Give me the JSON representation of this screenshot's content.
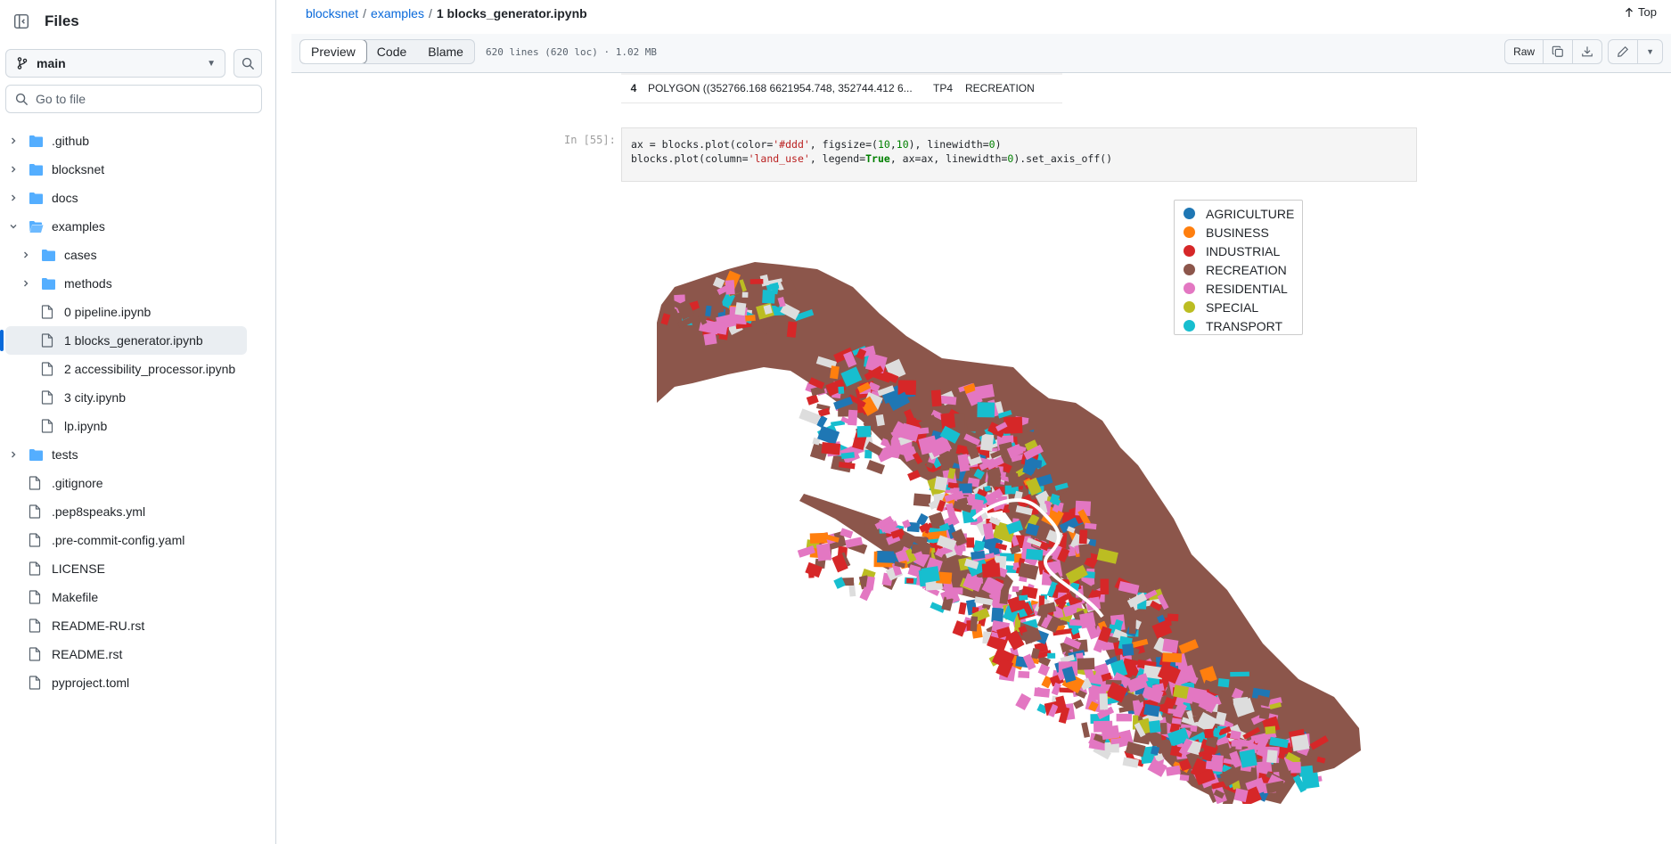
{
  "sidebar": {
    "title": "Files",
    "branch": "main",
    "goto_placeholder": "Go to file",
    "tree": [
      {
        "name": ".github",
        "type": "folder",
        "depth": 0,
        "expanded": false
      },
      {
        "name": "blocksnet",
        "type": "folder",
        "depth": 0,
        "expanded": false
      },
      {
        "name": "docs",
        "type": "folder",
        "depth": 0,
        "expanded": false
      },
      {
        "name": "examples",
        "type": "folder",
        "depth": 0,
        "expanded": true
      },
      {
        "name": "cases",
        "type": "folder",
        "depth": 1,
        "expanded": false
      },
      {
        "name": "methods",
        "type": "folder",
        "depth": 1,
        "expanded": false
      },
      {
        "name": "0 pipeline.ipynb",
        "type": "file",
        "depth": 1
      },
      {
        "name": "1 blocks_generator.ipynb",
        "type": "file",
        "depth": 1,
        "active": true
      },
      {
        "name": "2 accessibility_processor.ipynb",
        "type": "file",
        "depth": 1
      },
      {
        "name": "3 city.ipynb",
        "type": "file",
        "depth": 1
      },
      {
        "name": "lp.ipynb",
        "type": "file",
        "depth": 1
      },
      {
        "name": "tests",
        "type": "folder",
        "depth": 0,
        "expanded": false
      },
      {
        "name": ".gitignore",
        "type": "file",
        "depth": 0
      },
      {
        "name": ".pep8speaks.yml",
        "type": "file",
        "depth": 0
      },
      {
        "name": ".pre-commit-config.yaml",
        "type": "file",
        "depth": 0
      },
      {
        "name": "LICENSE",
        "type": "file",
        "depth": 0
      },
      {
        "name": "Makefile",
        "type": "file",
        "depth": 0
      },
      {
        "name": "README-RU.rst",
        "type": "file",
        "depth": 0
      },
      {
        "name": "README.rst",
        "type": "file",
        "depth": 0
      },
      {
        "name": "pyproject.toml",
        "type": "file",
        "depth": 0
      }
    ]
  },
  "breadcrumb": {
    "repo": "blocksnet",
    "sep1": "/",
    "folder": "examples",
    "sep2": "/",
    "file": "1 blocks_generator.ipynb"
  },
  "top_label": "Top",
  "filebar": {
    "tabs": [
      "Preview",
      "Code",
      "Blame"
    ],
    "active_tab": "Preview",
    "info": "620 lines (620 loc) · 1.02 MB",
    "raw_label": "Raw"
  },
  "df_row": {
    "index": "4",
    "geometry": "POLYGON ((352766.168 6621954.748, 352744.412 6...",
    "zone": "TP4",
    "land_use": "RECREATION"
  },
  "cell": {
    "prompt": "In [55]:"
  },
  "legend": {
    "items": [
      {
        "label": "AGRICULTURE",
        "color": "#1f77b4"
      },
      {
        "label": "BUSINESS",
        "color": "#ff7f0e"
      },
      {
        "label": "INDUSTRIAL",
        "color": "#d62728"
      },
      {
        "label": "RECREATION",
        "color": "#8c564b"
      },
      {
        "label": "RESIDENTIAL",
        "color": "#e377c2"
      },
      {
        "label": "SPECIAL",
        "color": "#bcbd22"
      },
      {
        "label": "TRANSPORT",
        "color": "#17becf"
      }
    ]
  },
  "colors": {
    "accent": "#0969da",
    "border": "#d0d7de",
    "background_gray": "#dddddd"
  }
}
